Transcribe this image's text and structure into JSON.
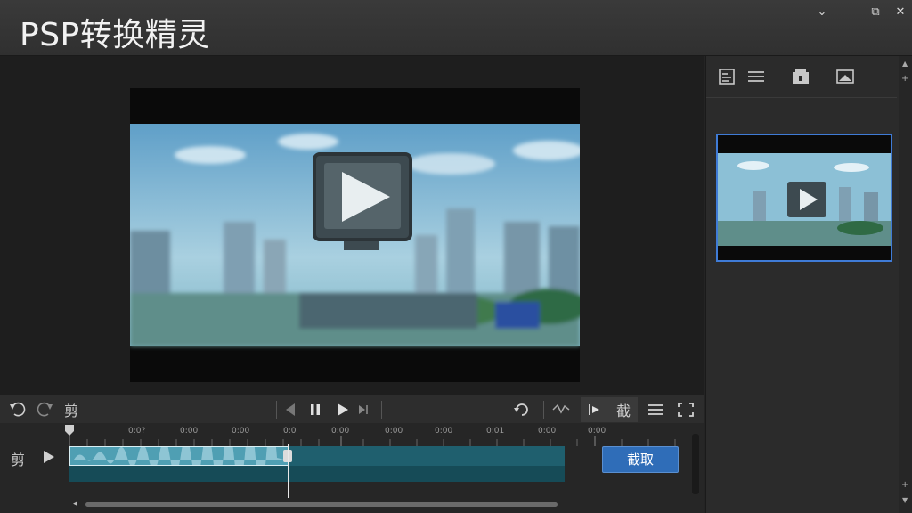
{
  "app": {
    "title": "PSP转换精灵"
  },
  "window_controls": {
    "collapse": "⌄",
    "minimize": "—",
    "restore": "⧉",
    "close": "✕"
  },
  "timeline": {
    "clip_label": "剪",
    "ruler_labels": [
      "0:0?",
      "0:00",
      "0:00",
      "0:0",
      "0:00",
      "0:00",
      "0:00",
      "0:01",
      "0:00",
      "0:00"
    ],
    "cut_button": "截取"
  },
  "controls": {
    "cut_tool_label": "剪",
    "intercept_label": "截"
  },
  "colors": {
    "accent": "#3f7bd6",
    "track": "#1f5f6e",
    "selection": "#4f9fb3",
    "button": "#2f6db8"
  }
}
